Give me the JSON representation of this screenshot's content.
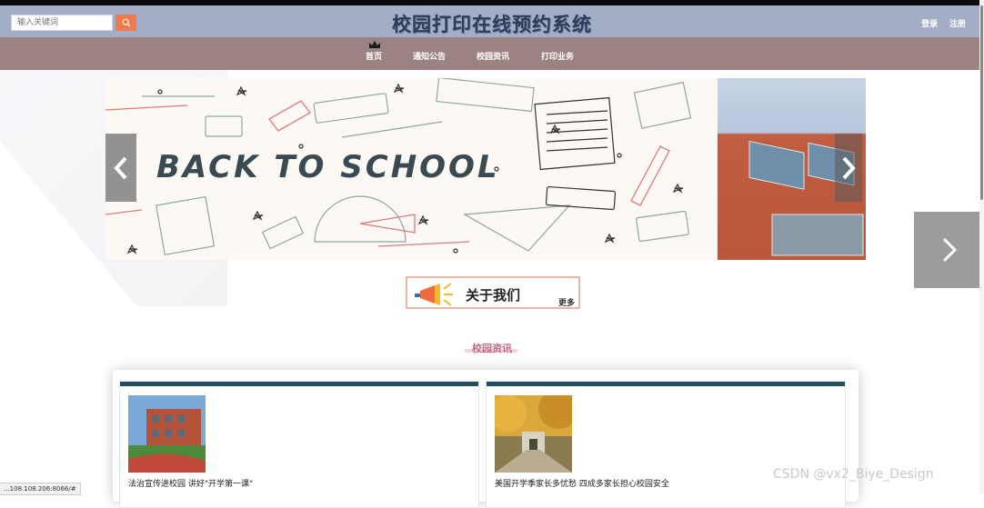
{
  "header": {
    "search_placeholder": "输入关键词",
    "title": "校园打印在线预约系统",
    "login": "登录",
    "register": "注册"
  },
  "nav": {
    "items": [
      "首页",
      "通知公告",
      "校园资讯",
      "打印业务"
    ]
  },
  "banner": {
    "text": "BACK TO SCHOOL"
  },
  "about": {
    "title": "关于我们",
    "more": "更多"
  },
  "news": {
    "section_title": "校园资讯",
    "items": [
      {
        "caption": "法治宣传进校园 讲好\"开学第一课\""
      },
      {
        "caption": "美国开学季家长多忧愁 四成多家长担心校园安全"
      }
    ]
  },
  "status_bar": {
    "url": "...108.108.206:8066/#"
  },
  "watermark": "CSDN @vx2_Biye_Design",
  "colors": {
    "header_bg": "#a3adc6",
    "nav_bg": "#9c8381",
    "search_button": "#f07a4c",
    "card_bar": "#214e5e"
  }
}
